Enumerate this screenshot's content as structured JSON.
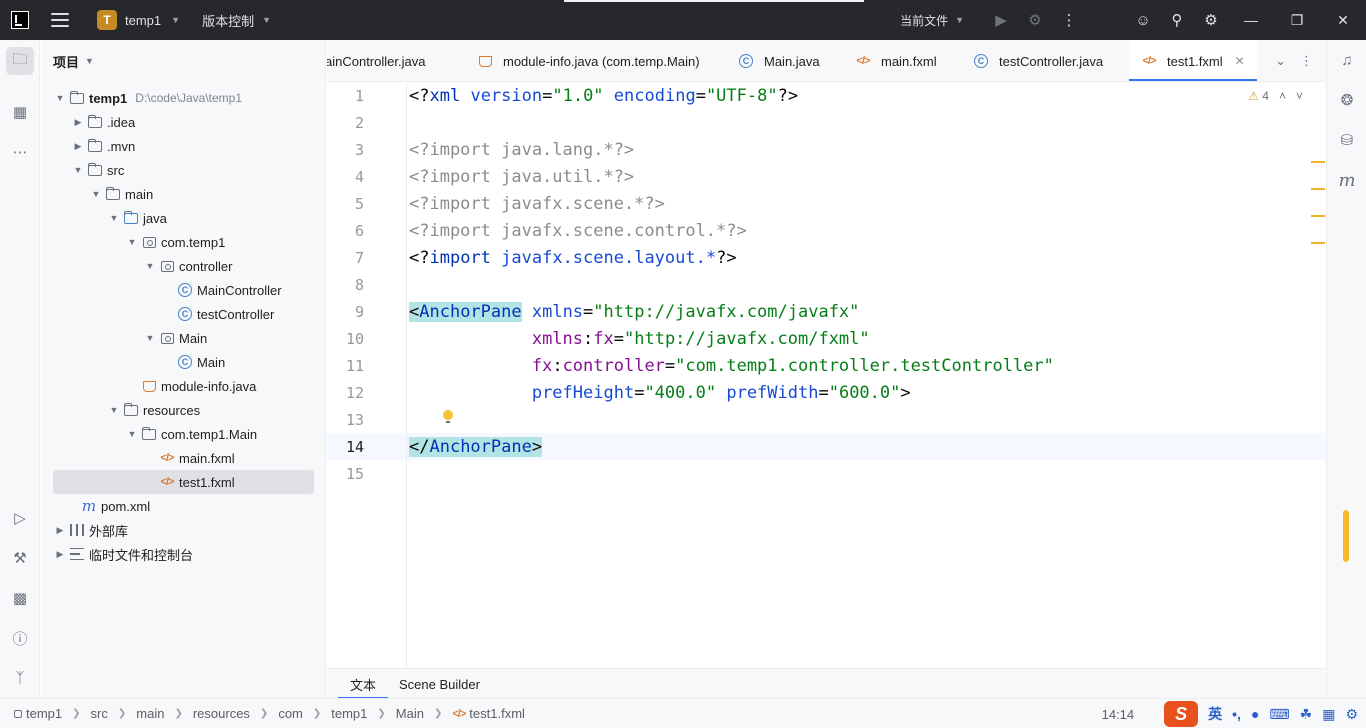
{
  "titlebar": {
    "project_badge": "T",
    "project_name": "temp1",
    "vcs_label": "版本控制",
    "current_file_label": "当前文件"
  },
  "project_panel": {
    "title": "项目",
    "tree": [
      {
        "label": "temp1",
        "path": "D:\\code\\Java\\temp1"
      },
      {
        "label": ".idea"
      },
      {
        "label": ".mvn"
      },
      {
        "label": "src"
      },
      {
        "label": "main"
      },
      {
        "label": "java"
      },
      {
        "label": "com.temp1"
      },
      {
        "label": "controller"
      },
      {
        "label": "MainController"
      },
      {
        "label": "testController"
      },
      {
        "label": "Main"
      },
      {
        "label": "Main"
      },
      {
        "label": "module-info.java"
      },
      {
        "label": "resources"
      },
      {
        "label": "com.temp1.Main"
      },
      {
        "label": "main.fxml"
      },
      {
        "label": "test1.fxml"
      },
      {
        "label": "pom.xml"
      },
      {
        "label": "外部库"
      },
      {
        "label": "临时文件和控制台"
      }
    ]
  },
  "tabs": [
    {
      "label": "ainController.java"
    },
    {
      "label": "module-info.java (com.temp.Main)"
    },
    {
      "label": "Main.java"
    },
    {
      "label": "main.fxml"
    },
    {
      "label": "testController.java"
    },
    {
      "label": "test1.fxml"
    }
  ],
  "editor": {
    "warning_count": "4",
    "line_numbers": [
      "1",
      "2",
      "3",
      "4",
      "5",
      "6",
      "7",
      "8",
      "9",
      "10",
      "11",
      "12",
      "13",
      "14",
      "15"
    ],
    "code": {
      "l1_pi_open": "<?",
      "l1_tag": "xml",
      "l1_attr1": "version",
      "l1_eq1": "=",
      "l1_val1": "\"1.0\"",
      "l1_attr2": "encoding",
      "l1_eq2": "=",
      "l1_val2": "\"UTF-8\"",
      "l1_pi_close": "?>",
      "l3": "<?import java.lang.*?>",
      "l4": "<?import java.util.*?>",
      "l5": "<?import javafx.scene.*?>",
      "l6": "<?import javafx.scene.control.*?>",
      "l7_open": "<?",
      "l7_kw": "import",
      "l7_target": "javafx.scene.layout.*",
      "l7_close": "?>",
      "l9_lt": "<",
      "l9_tag": "AnchorPane",
      "l9_attr": "xmlns",
      "l9_eq": "=",
      "l9_val": "\"http://javafx.com/javafx\"",
      "l10_ns": "xmlns",
      "l10_colon": ":",
      "l10_attr": "fx",
      "l10_eq": "=",
      "l10_val": "\"http://javafx.com/fxml\"",
      "l11_ns": "fx",
      "l11_colon": ":",
      "l11_attr": "controller",
      "l11_eq": "=",
      "l11_val": "\"com.temp1.controller.testController\"",
      "l12_attr1": "prefHeight",
      "l12_eq1": "=",
      "l12_val1": "\"400.0\"",
      "l12_attr2": "prefWidth",
      "l12_eq2": "=",
      "l12_val2": "\"600.0\"",
      "l12_gt": ">",
      "l14_open": "</",
      "l14_tag": "AnchorPane",
      "l14_gt": ">"
    }
  },
  "editor_tabs": [
    {
      "label": "文本"
    },
    {
      "label": "Scene Builder"
    }
  ],
  "statusbar": {
    "breadcrumbs": [
      "temp1",
      "src",
      "main",
      "resources",
      "com",
      "temp1",
      "Main",
      "test1.fxml"
    ],
    "position": "14:14",
    "ime_logo": "S",
    "ime_lang": "英",
    "ime_punct": "•,"
  },
  "colors": {
    "accent": "#3574f0",
    "titlebar_bg": "#27282c",
    "badge": "#c58a24",
    "warning": "#f0b328"
  }
}
